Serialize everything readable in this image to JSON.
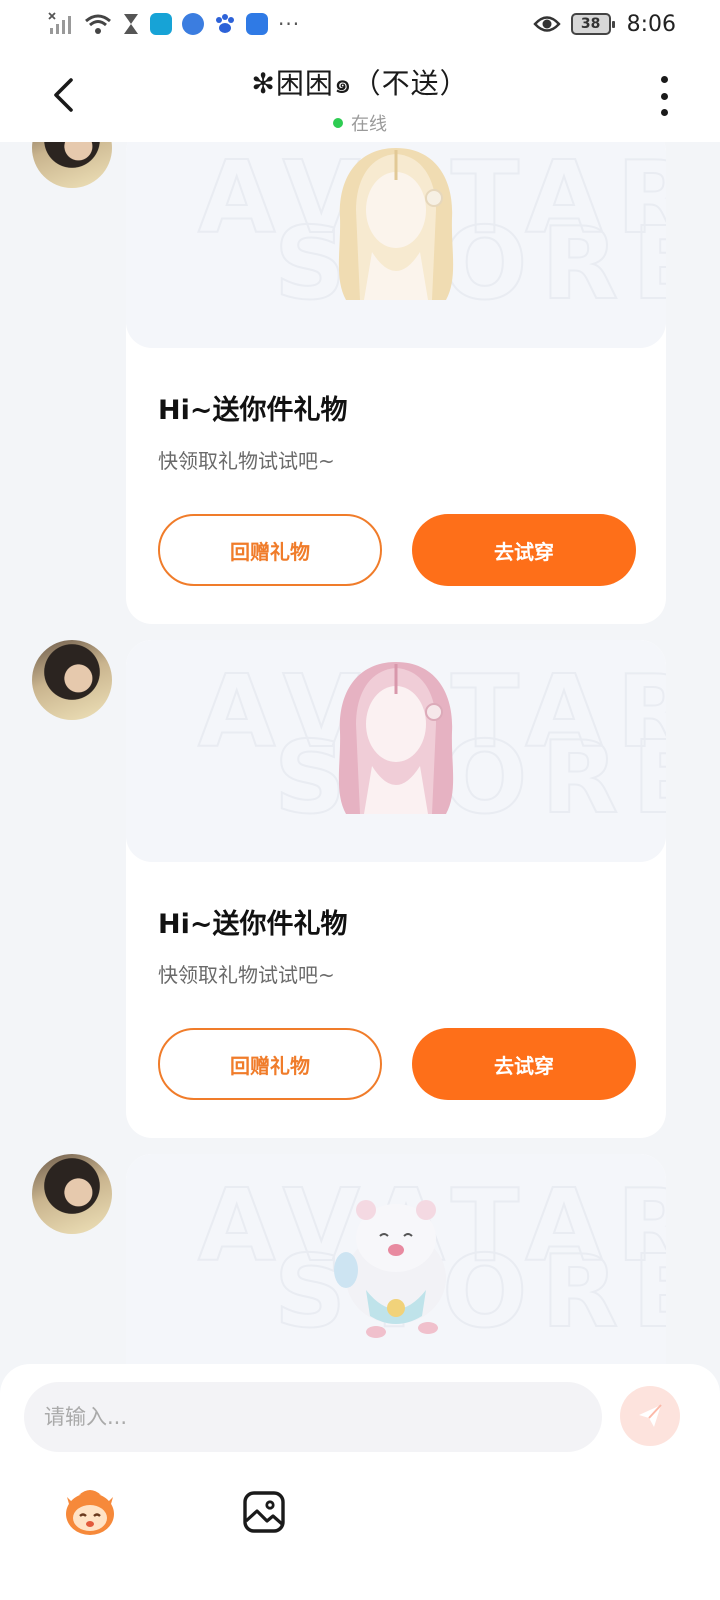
{
  "status_bar": {
    "time": "8:06",
    "battery": "38",
    "more": "···"
  },
  "header": {
    "title": "✻困困๑（不送）",
    "status": "在线"
  },
  "messages": [
    {
      "title": "Hi~送你件礼物",
      "subtitle": "快领取礼物试试吧~",
      "return_label": "回赠礼物",
      "try_label": "去试穿",
      "image": "blonde-hair-item"
    },
    {
      "title": "Hi~送你件礼物",
      "subtitle": "快领取礼物试试吧~",
      "return_label": "回赠礼物",
      "try_label": "去试穿",
      "image": "pink-hair-item"
    },
    {
      "image": "hamster-item"
    }
  ],
  "input": {
    "placeholder": "请输入..."
  },
  "colors": {
    "accent": "#fe6f19",
    "outline": "#f07c2a",
    "online": "#2ecc52"
  },
  "icons": [
    "back-arrow-icon",
    "more-vertical-icon",
    "send-icon",
    "mascot-icon",
    "image-icon"
  ]
}
